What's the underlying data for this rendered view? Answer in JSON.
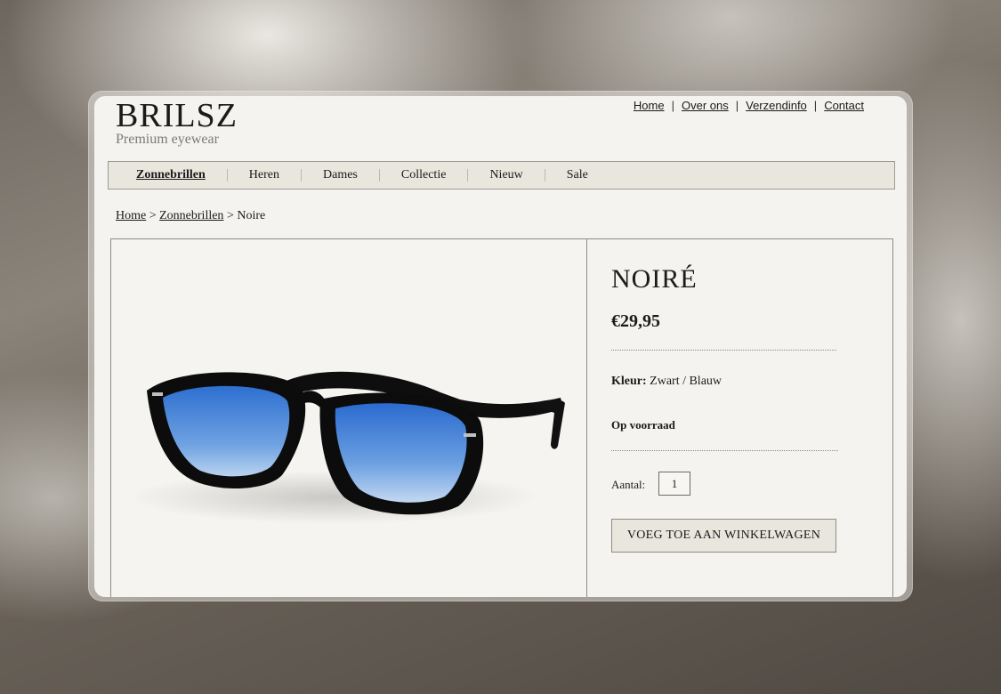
{
  "brand": {
    "logo": "BRILSZ",
    "tagline": "Premium eyewear"
  },
  "topnav": [
    "Home",
    "Over ons",
    "Verzendinfo",
    "Contact"
  ],
  "categories": [
    "Zonnebrillen",
    "Heren",
    "Dames",
    "Collectie",
    "Nieuw",
    "Sale"
  ],
  "active_category": "Zonnebrillen",
  "breadcrumb": {
    "home": "Home",
    "category": "Zonnebrillen",
    "current": "Noire",
    "separator": ">"
  },
  "product": {
    "title": "NOIRÉ",
    "price": "€29,95",
    "color_label": "Kleur:",
    "color_value": "Zwart / Blauw",
    "stock": "Op voorraad",
    "quantity_label": "Aantal:",
    "quantity": "1",
    "add_button": "VOEG TOE AAN WINKELWAGEN",
    "image_icon": "sunglasses-product-image",
    "frame_color": "#111111",
    "lens_color": "#3f7fd6"
  }
}
